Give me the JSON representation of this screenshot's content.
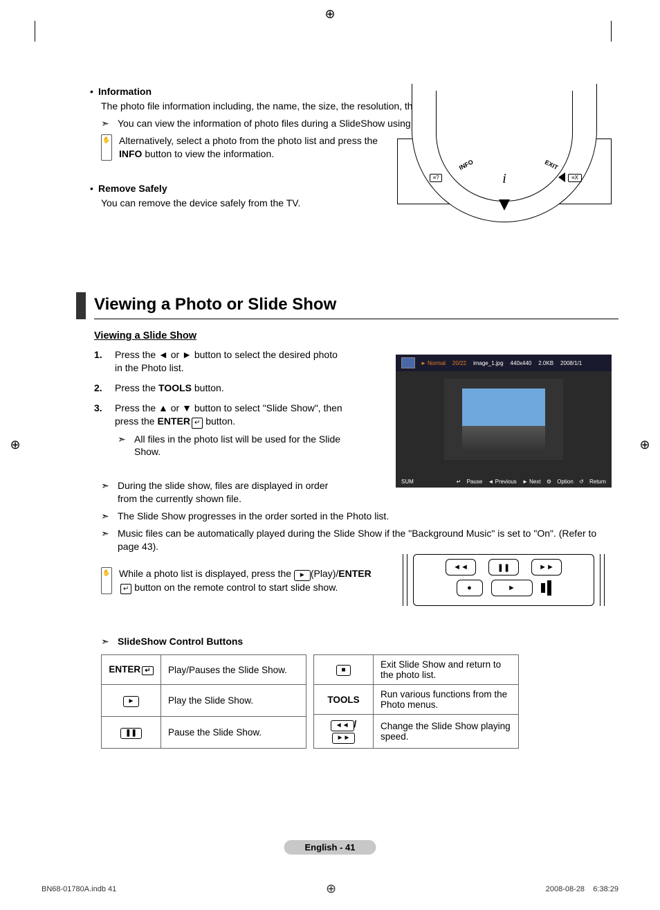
{
  "info_section": {
    "heading": "Information",
    "body": "The photo file information including, the name, the size, the resolution, the date modified and the path is displayed.",
    "arrow_note": "You can view the information of photo files during a SlideShow using the same procedures.",
    "box_note_pre": "Alternatively, select a photo from the photo list and press the ",
    "box_note_bold": "INFO",
    "box_note_post": " button to view the information."
  },
  "remove_section": {
    "heading": "Remove Safely",
    "body": "You can remove the device safely from the TV."
  },
  "remote_fig": {
    "info_label": "INFO",
    "exit_label": "EXIT",
    "i_glyph": "i",
    "left_btn": "≡?",
    "right_btn": "≡X"
  },
  "section_title": "Viewing a Photo or Slide Show",
  "sub_title": "Viewing a Slide Show",
  "steps": {
    "s1_pre": "Press the ◄ or ► button to select the desired photo in the Photo list.",
    "s2_pre": "Press the ",
    "s2_bold": "TOOLS",
    "s2_post": " button.",
    "s3_pre": "Press the ▲ or ▼ button to select \"Slide Show\", then press the ",
    "s3_bold": "ENTER",
    "s3_post": " button.",
    "s3_sub": "All files in the photo list will be used for the Slide Show."
  },
  "arrows": {
    "a1": "During the slide show, files are displayed in order from the currently shown file.",
    "a2": "The Slide Show progresses in the order sorted in the Photo list.",
    "a3": "Music files can be automatically played during the Slide Show if the \"Background Music\" is set to \"On\". (Refer to page 43)."
  },
  "box_note2": {
    "pre": "While a photo list is displayed, press the ",
    "play_glyph": "►",
    "mid": "(Play)/",
    "bold": "ENTER",
    "post": " button on the remote control to start slide show."
  },
  "screen": {
    "normal": "► Normal",
    "count": "20/22",
    "filename": "image_1.jpg",
    "res": "440x440",
    "size": "2.0KB",
    "date": "2008/1/1",
    "sum": "SUM",
    "c_pause": "Pause",
    "c_prev": "◄ Previous",
    "c_next": "► Next",
    "c_option": "Option",
    "c_return": "Return"
  },
  "ctrl_heading": "SlideShow Control Buttons",
  "ctrl_table": {
    "l1k": "ENTER",
    "l1d": "Play/Pauses the Slide Show.",
    "l2d": "Play the Slide Show.",
    "l3d": "Pause the Slide Show.",
    "r1d": "Exit Slide Show and return to the photo list.",
    "r2k": "TOOLS",
    "r2d": "Run various functions from the Photo menus.",
    "r3d": "Change the Slide Show playing speed."
  },
  "enter_glyph": "↵",
  "play_glyph": "►",
  "pause_glyph": "❚❚",
  "stop_glyph": "■",
  "rew_glyph": "◄◄",
  "ff_glyph": "►►",
  "rec_glyph": "●",
  "page_footer": "English - 41",
  "doc_footer_left": "BN68-01780A.indb   41",
  "doc_footer_right": "2008-08-28      6:38:29"
}
